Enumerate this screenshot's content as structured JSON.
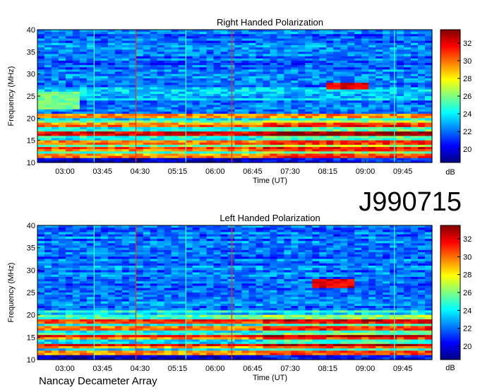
{
  "observation_id": "J990715",
  "footer": "Nancay Decameter Array",
  "chart_data": [
    {
      "type": "heatmap",
      "title": "Right Handed Polarization",
      "xlabel": "Time (UT)",
      "ylabel": "Frequency (MHz)",
      "x_ticks": [
        "03:00",
        "03:45",
        "04:30",
        "05:15",
        "06:00",
        "06:45",
        "07:30",
        "08:15",
        "09:00",
        "09:45"
      ],
      "y_ticks": [
        10,
        15,
        20,
        25,
        30,
        35,
        40
      ],
      "ylim": [
        10,
        40
      ],
      "colorbar": {
        "label": "dB",
        "ticks": [
          20,
          22,
          24,
          26,
          28,
          30,
          32
        ],
        "range": [
          18.5,
          33.5
        ]
      },
      "colormap": [
        "#00007f",
        "#0000ff",
        "#0080ff",
        "#00ffff",
        "#80ff80",
        "#ffff00",
        "#ff8000",
        "#ff0000",
        "#7f0000"
      ],
      "features": {
        "strong_bands_mhz": [
          11.5,
          13,
          14.5,
          16.5,
          18.5,
          20.5
        ],
        "emission_patch": {
          "time": [
            "08:15",
            "09:00"
          ],
          "freq_mhz": [
            26.5,
            28
          ]
        },
        "vertical_lines": [
          "03:35",
          "04:25",
          "05:25",
          "06:20",
          "09:35"
        ]
      }
    },
    {
      "type": "heatmap",
      "title": "Left Handed Polarization",
      "xlabel": "Time (UT)",
      "ylabel": "Frequency (MHz)",
      "x_ticks": [
        "03:00",
        "03:45",
        "04:30",
        "05:15",
        "06:00",
        "06:45",
        "07:30",
        "08:15",
        "09:00",
        "09:45"
      ],
      "y_ticks": [
        10,
        15,
        20,
        25,
        30,
        35,
        40
      ],
      "ylim": [
        10,
        40
      ],
      "colorbar": {
        "label": "dB",
        "ticks": [
          20,
          22,
          24,
          26,
          28,
          30,
          32
        ],
        "range": [
          18.5,
          33.5
        ]
      },
      "colormap": [
        "#00007f",
        "#0000ff",
        "#0080ff",
        "#00ffff",
        "#80ff80",
        "#ffff00",
        "#ff8000",
        "#ff0000",
        "#7f0000"
      ],
      "features": {
        "strong_bands_mhz": [
          11.5,
          13,
          15,
          17,
          18.5
        ],
        "emission_patch": {
          "time": [
            "08:00",
            "08:50"
          ],
          "freq_mhz": [
            26,
            28
          ]
        },
        "vertical_lines": [
          "03:35",
          "04:25",
          "05:25",
          "06:20",
          "09:35"
        ]
      }
    }
  ]
}
